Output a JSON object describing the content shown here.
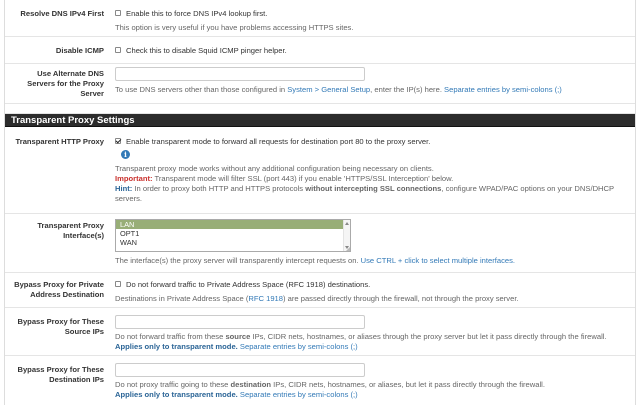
{
  "dns_ipv4": {
    "label": "Resolve DNS IPv4 First",
    "checkbox_text": "Enable this to force DNS IPv4 lookup first.",
    "help": "This option is very useful if you have problems accessing HTTPS sites.",
    "checked": false
  },
  "icmp": {
    "label": "Disable ICMP",
    "checkbox_text": "Check this to disable Squid ICMP pinger helper.",
    "checked": false
  },
  "alt_dns": {
    "label_l1": "Use Alternate DNS",
    "label_l2": "Servers for the Proxy",
    "label_l3": "Server",
    "value": "",
    "help_pre": "To use DNS servers other than those configured in ",
    "help_link": "System > General Setup",
    "help_mid": ", enter the IP(s) here. ",
    "help_sep": "Separate entries by semi-colons (;)"
  },
  "section": {
    "title": "Transparent Proxy Settings"
  },
  "transparent": {
    "label": "Transparent HTTP Proxy",
    "checkbox_text": "Enable transparent mode to forward all requests for destination port 80 to the proxy server.",
    "checked": true,
    "info_icon": "info-icon",
    "note1": "Transparent proxy mode works without any additional configuration being necessary on clients.",
    "important_label": "Important:",
    "important_text": " Transparent mode will filter SSL (port 443) if you enable 'HTTPS/SSL Interception' below.",
    "hint_label": "Hint:",
    "hint_text_1": " In order to proxy both HTTP and HTTPS protocols ",
    "hint_bold": "without intercepting SSL connections",
    "hint_text_2": ", configure WPAD/PAC options on your DNS/DHCP",
    "hint_text_3": "servers."
  },
  "interfaces": {
    "label_l1": "Transparent Proxy",
    "label_l2": "Interface(s)",
    "options": [
      "LAN",
      "OPT1",
      "WAN"
    ],
    "selected": "LAN",
    "help_pre": "The interface(s) the proxy server will transparently intercept requests on. ",
    "help_link": "Use CTRL + click to select multiple interfaces."
  },
  "bypass_private": {
    "label_l1": "Bypass Proxy for Private",
    "label_l2": "Address Destination",
    "checkbox_pre": "Do not forward traffic to Private Address Space (",
    "checkbox_link": "RFC 1918",
    "checkbox_post": ") destinations.",
    "checked": false,
    "help_pre": "Destinations in Private Address Space (",
    "help_link": "RFC 1918",
    "help_post": ") are passed directly through the firewall, not through the proxy server."
  },
  "bypass_source": {
    "label_l1": "Bypass Proxy for These",
    "label_l2": "Source IPs",
    "value": "",
    "help_pre": "Do not forward traffic from these ",
    "help_bold": "source",
    "help_post": " IPs, CIDR nets, hostnames, or aliases through the proxy server but let it pass directly through the firewall.",
    "applies": "Applies only to transparent mode.",
    "sep": " Separate entries by semi-colons (;)"
  },
  "bypass_dest": {
    "label_l1": "Bypass Proxy for These",
    "label_l2": "Destination IPs",
    "value": "",
    "help_pre": "Do not proxy traffic going to these ",
    "help_bold": "destination",
    "help_post": " IPs, CIDR nets, hostnames, or aliases, but let it pass directly through the firewall.",
    "applies": "Applies only to transparent mode.",
    "sep": " Separate entries by semi-colons (;)"
  }
}
